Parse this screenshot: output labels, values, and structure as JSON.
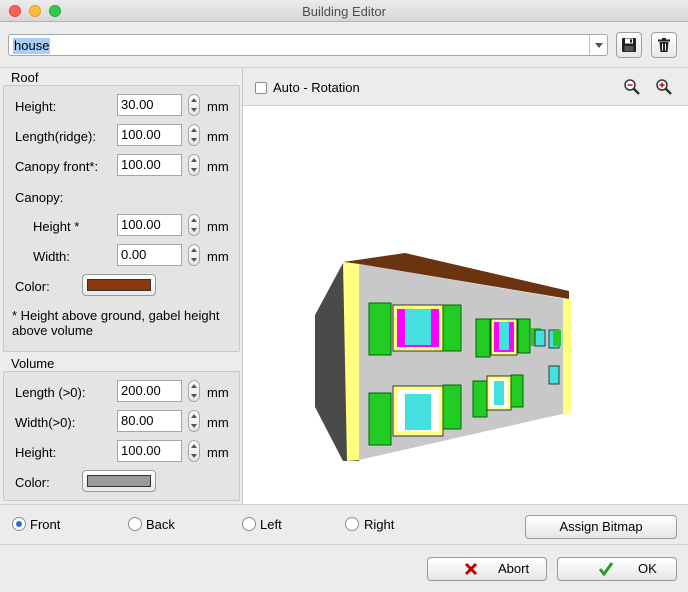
{
  "window": {
    "title": "Building Editor"
  },
  "toolbar": {
    "building_name": "house"
  },
  "roof": {
    "section_label": "Roof",
    "height_label": "Height:",
    "height_value": "30.00",
    "length_label": "Length(ridge):",
    "length_value": "100.00",
    "canopy_front_label": "Canopy front*:",
    "canopy_front_value": "100.00",
    "canopy_label": "Canopy:",
    "canopy_height_label": "Height *",
    "canopy_height_value": "100.00",
    "canopy_width_label": "Width:",
    "canopy_width_value": "0.00",
    "color_label": "Color:",
    "color": "#8b3a10",
    "unit": "mm",
    "note": "* Height above ground, gabel height above volume"
  },
  "volume": {
    "section_label": "Volume",
    "length_label": "Length (>0):",
    "length_value": "200.00",
    "width_label": "Width(>0):",
    "width_value": "80.00",
    "height_label": "Height:",
    "height_value": "100.00",
    "color_label": "Color:",
    "color": "#9a9a9a",
    "unit": "mm"
  },
  "preview": {
    "auto_rotation_label": "Auto - Rotation",
    "auto_rotation_checked": false
  },
  "view": {
    "front_label": "Front",
    "back_label": "Back",
    "left_label": "Left",
    "right_label": "Right",
    "selected": "Front",
    "assign_bitmap_label": "Assign Bitmap"
  },
  "footer": {
    "abort_label": "Abort",
    "ok_label": "OK"
  }
}
